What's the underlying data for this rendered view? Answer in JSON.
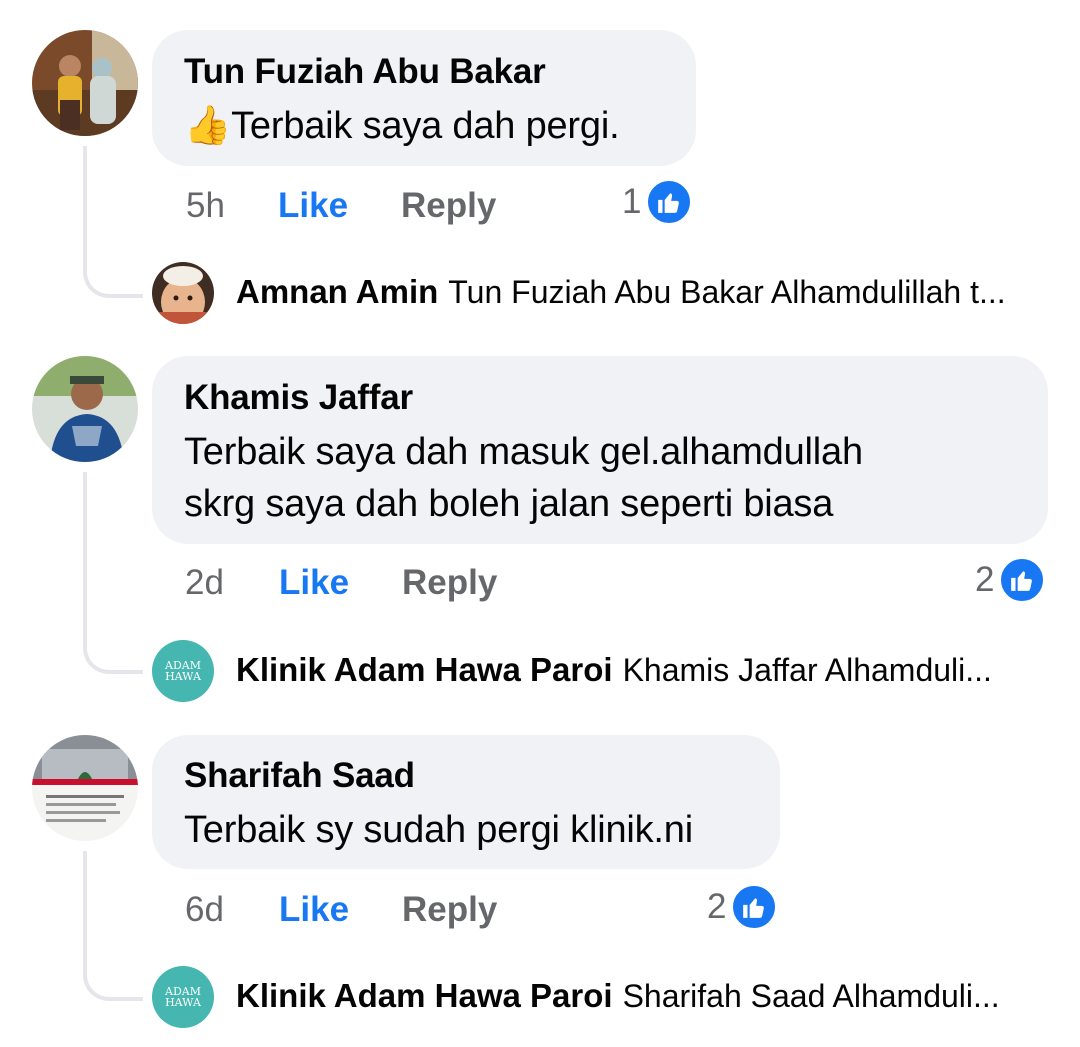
{
  "comments": [
    {
      "author": "Tun Fuziah Abu Bakar",
      "emoji": "👍",
      "lines": [
        "Terbaik saya dah pergi."
      ],
      "time": "5h",
      "like": "Like",
      "reply": "Reply",
      "reactions": "1",
      "reply_preview": {
        "author": "Amnan Amin",
        "text": "Tun Fuziah Abu Bakar Alhamdulillah t..."
      }
    },
    {
      "author": "Khamis Jaffar",
      "lines": [
        "Terbaik saya dah masuk gel.alhamdullah",
        "skrg saya dah boleh jalan seperti biasa"
      ],
      "time": "2d",
      "like": "Like",
      "reply": "Reply",
      "reactions": "2",
      "reply_preview": {
        "author": "Klinik Adam Hawa Paroi",
        "text": "Khamis Jaffar Alhamduli..."
      }
    },
    {
      "author": "Sharifah Saad",
      "lines": [
        "Terbaik sy sudah pergi klinik.ni"
      ],
      "time": "6d",
      "like": "Like",
      "reply": "Reply",
      "reactions": "2",
      "reply_preview": {
        "author": "Klinik Adam Hawa Paroi",
        "text": "Sharifah Saad Alhamduli..."
      }
    }
  ],
  "logo_text": {
    "line1": "ADAM",
    "line2": "HAWA"
  },
  "colors": {
    "bubble": "#f0f2f5",
    "like_blue": "#1877f2",
    "meta_gray": "#65676b",
    "logo_teal": "#46b6b0"
  }
}
